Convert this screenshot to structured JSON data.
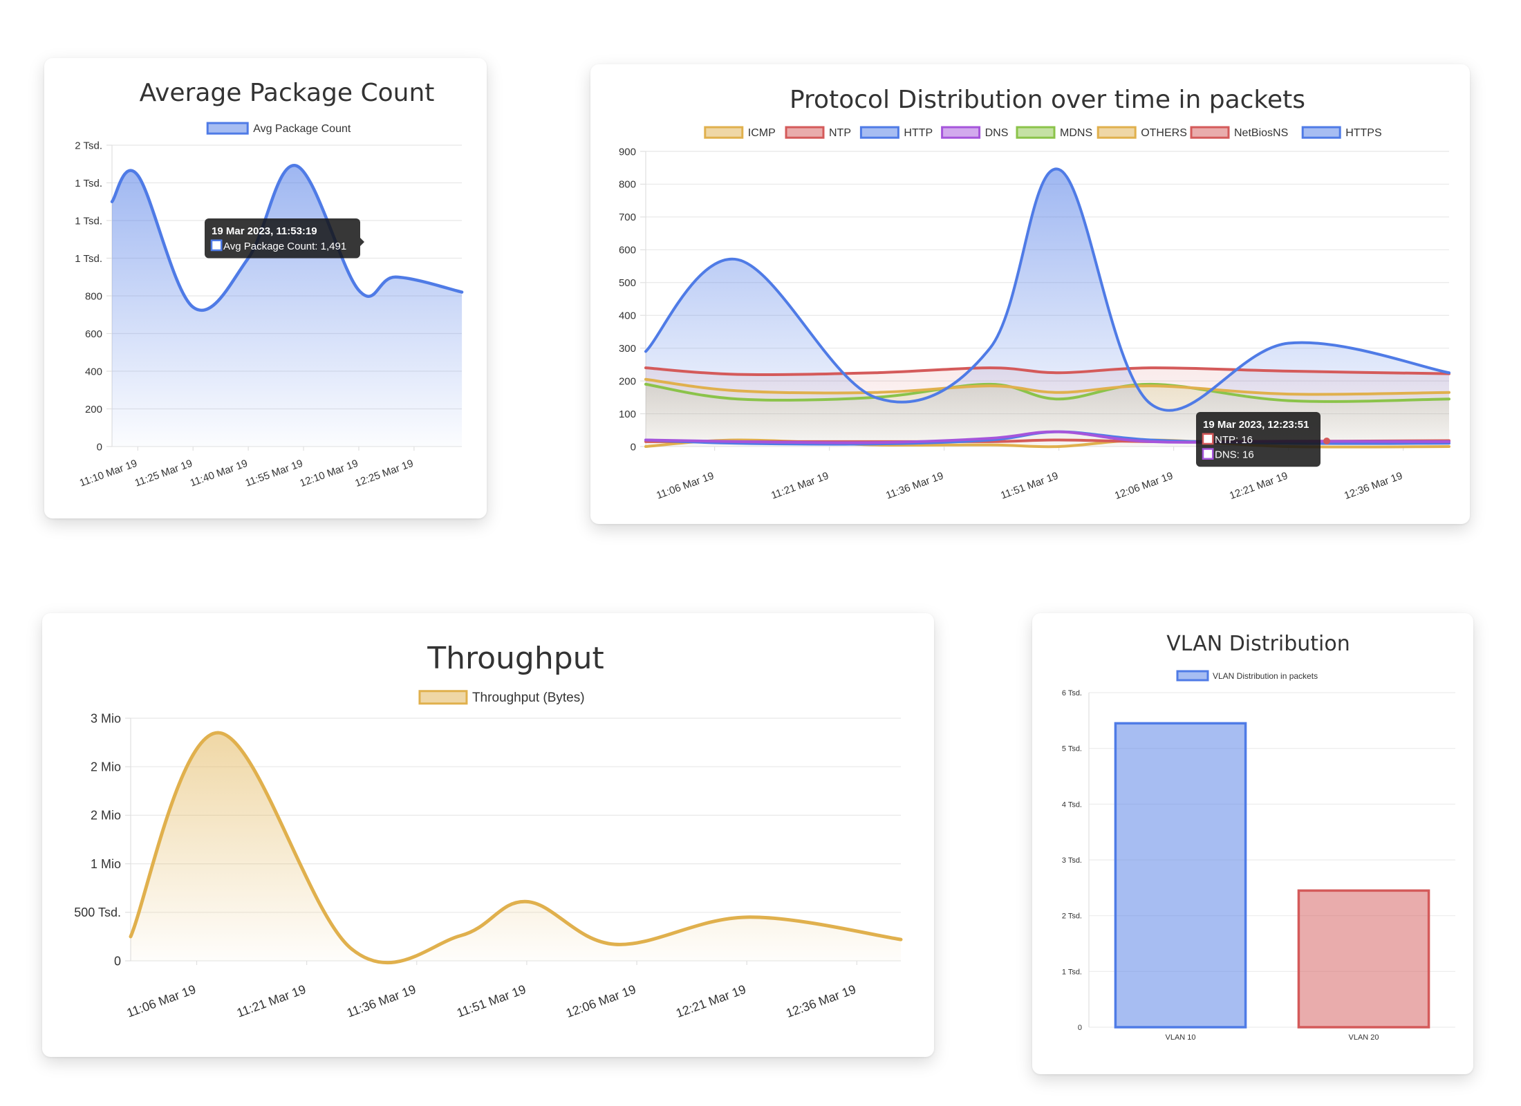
{
  "chart_data": [
    {
      "id": "avg",
      "type": "line",
      "title": "Average Package Count",
      "series": [
        {
          "name": "Avg Package Count",
          "color": "#4f7be6",
          "fill": "#4f7be6",
          "values": [
            1300,
            1440,
            740,
            1000,
            1491,
            830,
            900,
            820
          ]
        }
      ],
      "x": [
        "11:03",
        "11:10",
        "11:25",
        "11:40",
        "11:53",
        "12:10",
        "12:20",
        "12:38"
      ],
      "xtick_labels": [
        "11:10 Mar 19",
        "11:25 Mar 19",
        "11:40 Mar 19",
        "11:55 Mar 19",
        "12:10 Mar 19",
        "12:25 Mar 19"
      ],
      "ytick_labels": [
        "0",
        "200",
        "400",
        "600",
        "800",
        "1 Tsd.",
        "1 Tsd.",
        "1 Tsd.",
        "2 Tsd."
      ],
      "ylim": [
        0,
        1600
      ],
      "grid": true,
      "legend_position": "top",
      "tooltip": {
        "title": "19 Mar 2023, 11:53:19",
        "lines": [
          {
            "color": "#4f7be6",
            "text": "Avg Package Count: 1,491"
          }
        ]
      }
    },
    {
      "id": "proto",
      "type": "line",
      "title": "Protocol Distribution over time in packets",
      "x_ticks_pos": [
        11.1,
        11.35,
        11.6,
        11.85,
        12.1,
        12.35,
        12.6
      ],
      "xtick_labels": [
        "11:06 Mar 19",
        "11:21 Mar 19",
        "11:36 Mar 19",
        "11:51 Mar 19",
        "12:06 Mar 19",
        "12:21 Mar 19",
        "12:36 Mar 19"
      ],
      "ytick_labels": [
        "0",
        "100",
        "200",
        "300",
        "400",
        "500",
        "600",
        "700",
        "800",
        "900"
      ],
      "ylim": [
        0,
        900
      ],
      "grid": true,
      "legend_position": "top",
      "series": [
        {
          "name": "ICMP",
          "color": "#e0b04d",
          "values": [
            0,
            20,
            5,
            5,
            0,
            20,
            0,
            0
          ]
        },
        {
          "name": "NTP",
          "color": "#d45a5a",
          "values": [
            15,
            15,
            15,
            15,
            20,
            15,
            16,
            18
          ]
        },
        {
          "name": "HTTP",
          "color": "#4f7be6",
          "values": [
            20,
            10,
            8,
            20,
            45,
            20,
            10,
            10
          ]
        },
        {
          "name": "DNS",
          "color": "#a555db",
          "values": [
            20,
            15,
            12,
            25,
            45,
            15,
            16,
            15
          ]
        },
        {
          "name": "MDNS",
          "color": "#8bc34a",
          "values": [
            190,
            145,
            150,
            190,
            145,
            190,
            140,
            145
          ]
        },
        {
          "name": "OTHERS",
          "color": "#e0b04d",
          "values": [
            205,
            170,
            165,
            185,
            165,
            185,
            160,
            165
          ]
        },
        {
          "name": "NetBiosNS",
          "color": "#d45a5a",
          "values": [
            240,
            220,
            225,
            240,
            225,
            240,
            230,
            222
          ]
        },
        {
          "name": "HTTPS",
          "color": "#4f7be6",
          "values": [
            290,
            570,
            150,
            300,
            845,
            130,
            315,
            225
          ]
        }
      ],
      "x": [
        10.95,
        11.15,
        11.45,
        11.7,
        11.85,
        12.05,
        12.35,
        12.7
      ],
      "tooltip": {
        "title": "19 Mar 2023, 12:23:51",
        "lines": [
          {
            "color": "#d45a5a",
            "text": "NTP: 16"
          },
          {
            "color": "#a555db",
            "text": "DNS: 16"
          }
        ]
      }
    },
    {
      "id": "thr",
      "type": "area",
      "title": "Throughput",
      "series": [
        {
          "name": "Throughput (Bytes)",
          "color": "#e0b04d",
          "values": [
            250000,
            2350000,
            130000,
            260000,
            610000,
            170000,
            450000,
            220000
          ]
        }
      ],
      "x": [
        10.95,
        11.15,
        11.45,
        11.7,
        11.85,
        12.05,
        12.35,
        12.7
      ],
      "x_ticks_pos": [
        11.1,
        11.35,
        11.6,
        11.85,
        12.1,
        12.35,
        12.6
      ],
      "xtick_labels": [
        "11:06 Mar 19",
        "11:21 Mar 19",
        "11:36 Mar 19",
        "11:51 Mar 19",
        "12:06 Mar 19",
        "12:21 Mar 19",
        "12:36 Mar 19"
      ],
      "ytick_labels": [
        "0",
        "500 Tsd.",
        "1 Mio",
        "2 Mio",
        "2 Mio",
        "3 Mio"
      ],
      "ylim": [
        0,
        2500000
      ],
      "grid": true,
      "legend_position": "top"
    },
    {
      "id": "vlan",
      "type": "bar",
      "title": "VLAN Distribution",
      "categories": [
        "VLAN 10",
        "VLAN 20"
      ],
      "series": [
        {
          "name": "VLAN Distribution in packets",
          "values": [
            5450,
            2450
          ],
          "colors": [
            "#4f7be6",
            "#d45a5a"
          ]
        }
      ],
      "ytick_labels": [
        "0",
        "1 Tsd.",
        "2 Tsd.",
        "3 Tsd.",
        "4 Tsd.",
        "5 Tsd.",
        "6 Tsd."
      ],
      "ylim": [
        0,
        6000
      ],
      "grid": true,
      "legend_position": "top"
    }
  ]
}
